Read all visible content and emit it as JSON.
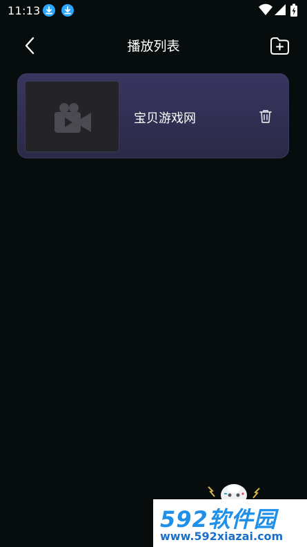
{
  "status_bar": {
    "time": "11:13",
    "notification_icons": [
      "download-icon",
      "download-icon"
    ],
    "system_icons": [
      "wifi-icon",
      "signal-icon",
      "battery-charging-icon"
    ]
  },
  "app_bar": {
    "title": "播放列表",
    "back_icon": "chevron-left-icon",
    "action_icon": "folder-add-icon"
  },
  "playlists": [
    {
      "name": "宝贝游戏网",
      "thumbnail_icon": "video-camera-icon",
      "action_icon": "trash-icon"
    }
  ],
  "watermark": {
    "brand": "592软件园",
    "url": "www.592xiazai.com"
  },
  "colors": {
    "background": "#070c0d",
    "card": "#35345a",
    "accent": "#2aa6ff",
    "watermark_blue": "#1f8fe8"
  }
}
